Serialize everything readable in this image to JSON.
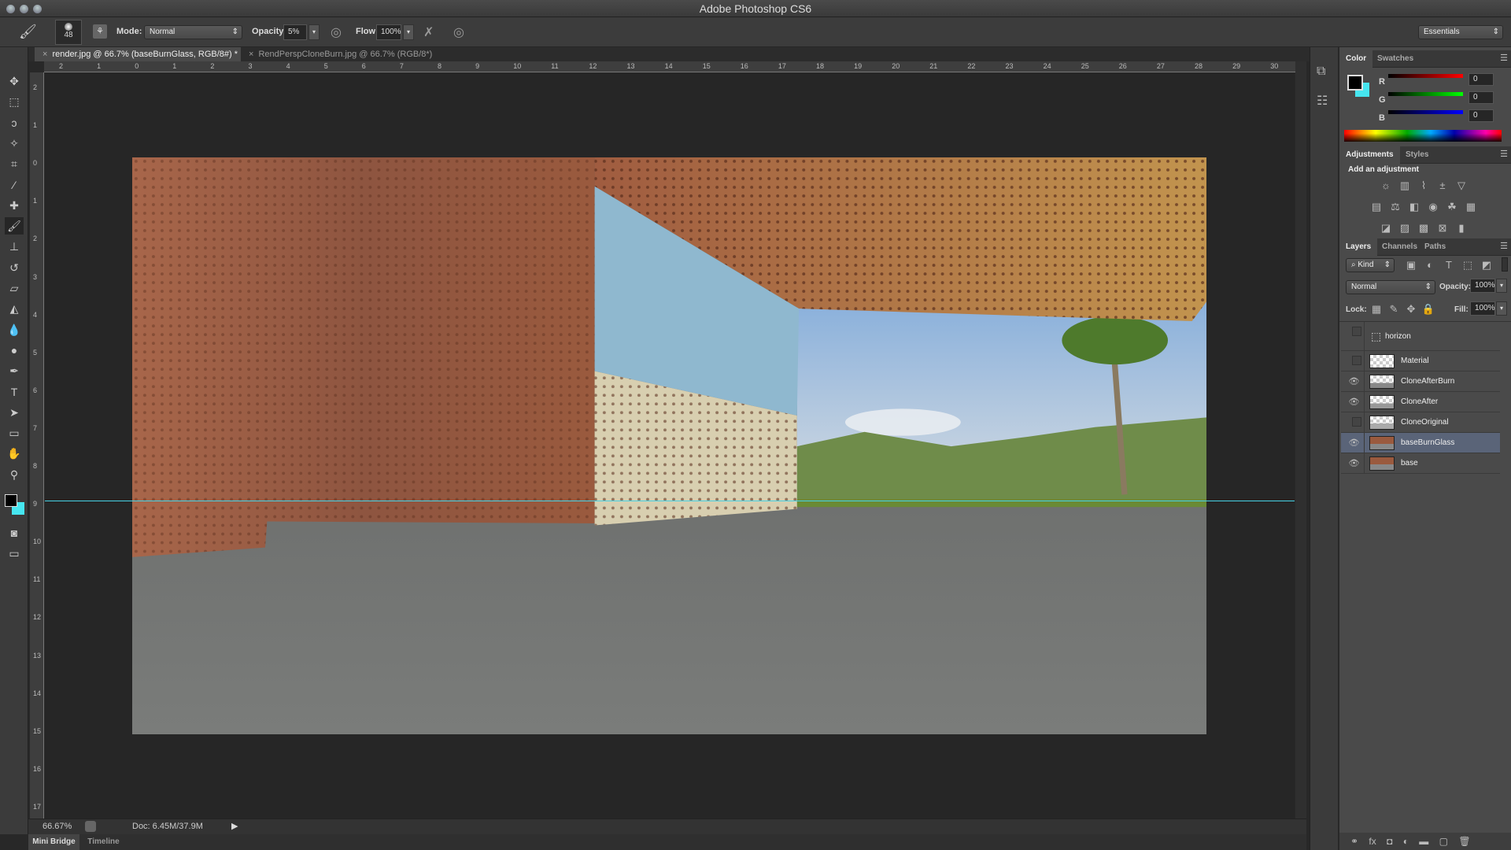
{
  "app": {
    "title": "Adobe Photoshop CS6"
  },
  "options": {
    "brush_size": "48",
    "mode_label": "Mode:",
    "mode_value": "Normal",
    "opacity_label": "Opacity:",
    "opacity_value": "5%",
    "flow_label": "Flow:",
    "flow_value": "100%",
    "workspace": "Essentials"
  },
  "documents": [
    {
      "label": "render.jpg @ 66.7% (baseBurnGlass, RGB/8#) *",
      "active": true
    },
    {
      "label": "RendPerspCloneBurn.jpg @ 66.7% (RGB/8*)",
      "active": false
    }
  ],
  "rulers": {
    "horizontal": [
      "2",
      "1",
      "0",
      "1",
      "2",
      "3",
      "4",
      "5",
      "6",
      "7",
      "8",
      "9",
      "10",
      "11",
      "12",
      "13",
      "14",
      "15",
      "16",
      "17",
      "18",
      "19",
      "20",
      "21",
      "22",
      "23",
      "24",
      "25",
      "26",
      "27",
      "28",
      "29",
      "30"
    ],
    "vertical": [
      "2",
      "1",
      "0",
      "1",
      "2",
      "3",
      "4",
      "5",
      "6",
      "7",
      "8",
      "9",
      "10",
      "11",
      "12",
      "13",
      "14",
      "15",
      "16",
      "17"
    ]
  },
  "tools": [
    "move-icon",
    "marquee-icon",
    "lasso-icon",
    "magic-wand-icon",
    "crop-icon",
    "eyedropper-icon",
    "healing-brush-icon",
    "brush-icon",
    "clone-stamp-icon",
    "history-brush-icon",
    "eraser-icon",
    "paint-bucket-icon",
    "blur-icon",
    "dodge-icon",
    "pen-icon",
    "type-icon",
    "path-selection-icon",
    "rectangle-icon",
    "hand-icon",
    "zoom-icon"
  ],
  "colors": {
    "foreground": "#000000",
    "background": "#46e6f0",
    "guide": "#46d2e6",
    "selected_layer": "#5a6478"
  },
  "status": {
    "zoom": "66.67%",
    "doc": "Doc: 6.45M/37.9M"
  },
  "bottom_tabs": [
    "Mini Bridge",
    "Timeline"
  ],
  "color_panel": {
    "tabs": [
      "Color",
      "Swatches"
    ],
    "channels": [
      {
        "label": "R",
        "value": "0"
      },
      {
        "label": "G",
        "value": "0"
      },
      {
        "label": "B",
        "value": "0"
      }
    ]
  },
  "adjustments_panel": {
    "tabs": [
      "Adjustments",
      "Styles"
    ],
    "heading": "Add an adjustment"
  },
  "layers_panel": {
    "tabs": [
      "Layers",
      "Channels",
      "Paths"
    ],
    "filter": "Kind",
    "blend_mode": "Normal",
    "opacity_label": "Opacity:",
    "opacity_value": "100%",
    "lock_label": "Lock:",
    "fill_label": "Fill:",
    "fill_value": "100%",
    "layers": [
      {
        "name": "horizon",
        "visible": false
      },
      {
        "name": "Material",
        "visible": false
      },
      {
        "name": "CloneAfterBurn",
        "visible": true
      },
      {
        "name": "CloneAfter",
        "visible": true
      },
      {
        "name": "CloneOriginal",
        "visible": false
      },
      {
        "name": "baseBurnGlass",
        "visible": true,
        "selected": true
      },
      {
        "name": "base",
        "visible": true
      }
    ]
  }
}
